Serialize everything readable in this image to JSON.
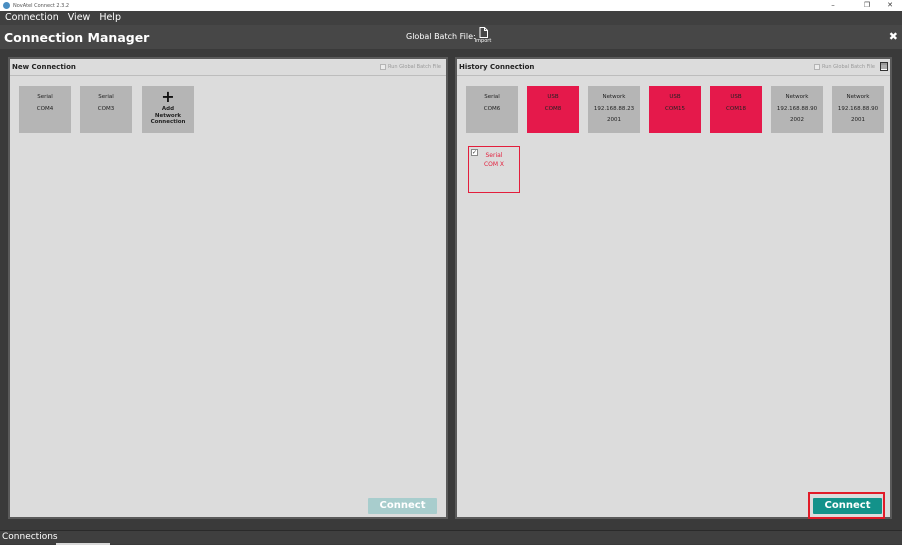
{
  "window": {
    "app_title": "NovAtel Connect 2.3.2",
    "minimize": "–",
    "maximize": "❐",
    "close": "✕"
  },
  "menu": [
    "Connection",
    "View",
    "Help"
  ],
  "header": {
    "title": "Connection Manager",
    "global_batch_label": "Global Batch File:",
    "import_label": "Import",
    "close_glyph": "✖"
  },
  "new_connection": {
    "title": "New Connection",
    "run_global_batch": "Run Global Batch File",
    "tiles": [
      {
        "type": "Serial",
        "port": "COM4"
      },
      {
        "type": "Serial",
        "port": "COM3"
      }
    ],
    "add_tile": {
      "plus": "+",
      "label_lines": [
        "Add",
        "Network",
        "Connection"
      ]
    },
    "connect_label": "Connect"
  },
  "history_connection": {
    "title": "History Connection",
    "run_global_batch": "Run Global Batch File",
    "tiles": [
      {
        "type": "Serial",
        "line2": "COM6",
        "line3": "",
        "kind": "serial"
      },
      {
        "type": "USB",
        "line2": "COM8",
        "line3": "",
        "kind": "usb"
      },
      {
        "type": "Network",
        "line2": "192.168.88.23",
        "line3": "2001",
        "kind": "network"
      },
      {
        "type": "USB",
        "line2": "COM15",
        "line3": "",
        "kind": "usb"
      },
      {
        "type": "USB",
        "line2": "COM18",
        "line3": "",
        "kind": "usb"
      },
      {
        "type": "Network",
        "line2": "192.168.88.90",
        "line3": "2002",
        "kind": "network"
      },
      {
        "type": "Network",
        "line2": "192.168.88.90",
        "line3": "2001",
        "kind": "network"
      }
    ],
    "selected_tile": {
      "type": "Serial",
      "port": "COM X",
      "checked": true
    },
    "connect_label": "Connect"
  },
  "statusbar": {
    "tab_label": "Connections"
  },
  "colors": {
    "usb": "#e5194b",
    "serial_network": "#b5b5b5",
    "connect": "#13928a",
    "connect_disabled": "#a8cdcd",
    "highlight": "#e11b28"
  },
  "icons": {
    "import": "file-import-icon",
    "close": "close-icon",
    "delete": "delete-icon"
  }
}
